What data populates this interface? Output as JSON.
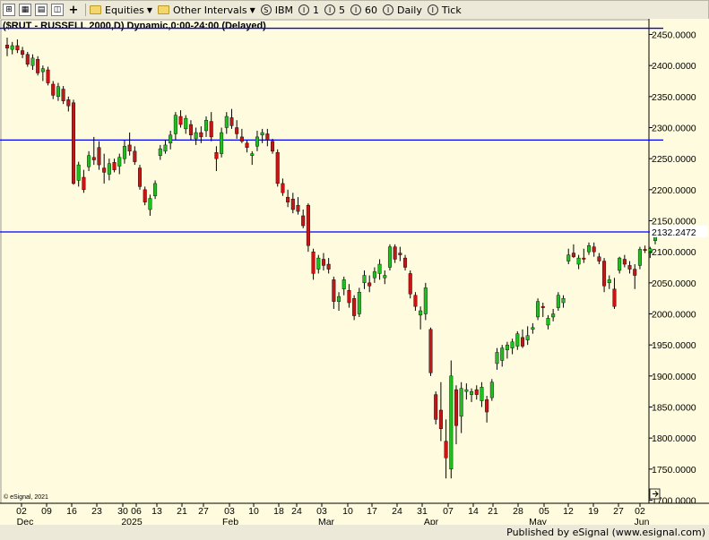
{
  "toolbar": {
    "equities_label": "Equities",
    "other_intervals_label": "Other Intervals",
    "symbol_label": "IBM",
    "interval_1": "1",
    "interval_5": "5",
    "interval_60": "60",
    "daily_label": "Daily",
    "tick_label": "Tick",
    "symbol_icon": "S",
    "interval_icon": "I"
  },
  "footer": {
    "published_text": "Published by eSignal (www.esignal.com)"
  },
  "chart_data": {
    "type": "candlestick",
    "title": "($RUT - RUSSELL 2000,D) Dynamic,0:00-24:00 (Delayed)",
    "watermark": "© eSignal, 2021",
    "y_range": [
      1700,
      2470
    ],
    "y_ticks": [
      "2450.0000",
      "2400.0000",
      "2350.0000",
      "2300.0000",
      "2250.0000",
      "2200.0000",
      "2150.0000",
      "2100.0000",
      "2050.0000",
      "2000.0000",
      "1950.0000",
      "1900.0000",
      "1850.0000",
      "1800.0000",
      "1750.0000",
      "1700.0000"
    ],
    "last_price_label": "2132.2472",
    "horizontal_lines": [
      2460,
      2280,
      2132
    ],
    "x_day_labels": [
      "02",
      "09",
      "16",
      "23",
      "30",
      "06",
      "13",
      "21",
      "27",
      "03",
      "10",
      "18",
      "24",
      "03",
      "10",
      "17",
      "24",
      "31",
      "07",
      "14",
      "21",
      "28",
      "05",
      "12",
      "19",
      "27",
      "02"
    ],
    "x_month_labels": [
      "Dec",
      "2025",
      "Feb",
      "Mar",
      "Apr",
      "May",
      "Jun"
    ],
    "colors": {
      "background": "#fefbde",
      "up": "#1fbf1f",
      "down": "#c81414",
      "line": "#0000ff",
      "wick": "#000000"
    },
    "candles": [
      {
        "o": 2433,
        "h": 2445,
        "l": 2415,
        "c": 2428
      },
      {
        "o": 2426,
        "h": 2438,
        "l": 2418,
        "c": 2432
      },
      {
        "o": 2432,
        "h": 2442,
        "l": 2420,
        "c": 2425
      },
      {
        "o": 2424,
        "h": 2430,
        "l": 2412,
        "c": 2418
      },
      {
        "o": 2418,
        "h": 2422,
        "l": 2398,
        "c": 2402
      },
      {
        "o": 2400,
        "h": 2418,
        "l": 2393,
        "c": 2412
      },
      {
        "o": 2410,
        "h": 2415,
        "l": 2384,
        "c": 2388
      },
      {
        "o": 2390,
        "h": 2400,
        "l": 2375,
        "c": 2395
      },
      {
        "o": 2393,
        "h": 2398,
        "l": 2368,
        "c": 2372
      },
      {
        "o": 2370,
        "h": 2375,
        "l": 2346,
        "c": 2352
      },
      {
        "o": 2350,
        "h": 2372,
        "l": 2343,
        "c": 2366
      },
      {
        "o": 2362,
        "h": 2367,
        "l": 2338,
        "c": 2343
      },
      {
        "o": 2345,
        "h": 2350,
        "l": 2326,
        "c": 2335
      },
      {
        "o": 2340,
        "h": 2345,
        "l": 2208,
        "c": 2210
      },
      {
        "o": 2215,
        "h": 2245,
        "l": 2205,
        "c": 2240
      },
      {
        "o": 2220,
        "h": 2232,
        "l": 2195,
        "c": 2200
      },
      {
        "o": 2237,
        "h": 2262,
        "l": 2230,
        "c": 2255
      },
      {
        "o": 2252,
        "h": 2285,
        "l": 2240,
        "c": 2248
      },
      {
        "o": 2268,
        "h": 2278,
        "l": 2232,
        "c": 2240
      },
      {
        "o": 2235,
        "h": 2258,
        "l": 2210,
        "c": 2228
      },
      {
        "o": 2225,
        "h": 2250,
        "l": 2215,
        "c": 2242
      },
      {
        "o": 2244,
        "h": 2250,
        "l": 2228,
        "c": 2232
      },
      {
        "o": 2238,
        "h": 2258,
        "l": 2225,
        "c": 2252
      },
      {
        "o": 2250,
        "h": 2280,
        "l": 2242,
        "c": 2270
      },
      {
        "o": 2272,
        "h": 2292,
        "l": 2255,
        "c": 2262
      },
      {
        "o": 2262,
        "h": 2270,
        "l": 2240,
        "c": 2245
      },
      {
        "o": 2235,
        "h": 2240,
        "l": 2200,
        "c": 2205
      },
      {
        "o": 2200,
        "h": 2205,
        "l": 2175,
        "c": 2180
      },
      {
        "o": 2168,
        "h": 2192,
        "l": 2158,
        "c": 2186
      },
      {
        "o": 2190,
        "h": 2215,
        "l": 2185,
        "c": 2210
      },
      {
        "o": 2255,
        "h": 2272,
        "l": 2248,
        "c": 2266
      },
      {
        "o": 2262,
        "h": 2280,
        "l": 2258,
        "c": 2272
      },
      {
        "o": 2275,
        "h": 2295,
        "l": 2265,
        "c": 2288
      },
      {
        "o": 2290,
        "h": 2325,
        "l": 2280,
        "c": 2320
      },
      {
        "o": 2318,
        "h": 2328,
        "l": 2300,
        "c": 2305
      },
      {
        "o": 2298,
        "h": 2320,
        "l": 2290,
        "c": 2315
      },
      {
        "o": 2305,
        "h": 2312,
        "l": 2280,
        "c": 2288
      },
      {
        "o": 2282,
        "h": 2300,
        "l": 2272,
        "c": 2292
      },
      {
        "o": 2292,
        "h": 2302,
        "l": 2275,
        "c": 2285
      },
      {
        "o": 2295,
        "h": 2318,
        "l": 2285,
        "c": 2312
      },
      {
        "o": 2310,
        "h": 2325,
        "l": 2278,
        "c": 2285
      },
      {
        "o": 2260,
        "h": 2270,
        "l": 2230,
        "c": 2250
      },
      {
        "o": 2258,
        "h": 2300,
        "l": 2252,
        "c": 2292
      },
      {
        "o": 2300,
        "h": 2325,
        "l": 2290,
        "c": 2318
      },
      {
        "o": 2316,
        "h": 2330,
        "l": 2298,
        "c": 2303
      },
      {
        "o": 2300,
        "h": 2312,
        "l": 2282,
        "c": 2290
      },
      {
        "o": 2285,
        "h": 2298,
        "l": 2275,
        "c": 2278
      },
      {
        "o": 2275,
        "h": 2280,
        "l": 2260,
        "c": 2268
      },
      {
        "o": 2255,
        "h": 2262,
        "l": 2240,
        "c": 2258
      },
      {
        "o": 2270,
        "h": 2295,
        "l": 2262,
        "c": 2285
      },
      {
        "o": 2288,
        "h": 2298,
        "l": 2275,
        "c": 2292
      },
      {
        "o": 2290,
        "h": 2298,
        "l": 2270,
        "c": 2280
      },
      {
        "o": 2278,
        "h": 2282,
        "l": 2258,
        "c": 2262
      },
      {
        "o": 2260,
        "h": 2265,
        "l": 2205,
        "c": 2210
      },
      {
        "o": 2210,
        "h": 2218,
        "l": 2190,
        "c": 2195
      },
      {
        "o": 2188,
        "h": 2200,
        "l": 2172,
        "c": 2180
      },
      {
        "o": 2185,
        "h": 2195,
        "l": 2162,
        "c": 2168
      },
      {
        "o": 2175,
        "h": 2188,
        "l": 2160,
        "c": 2165
      },
      {
        "o": 2158,
        "h": 2168,
        "l": 2138,
        "c": 2142
      },
      {
        "o": 2175,
        "h": 2178,
        "l": 2100,
        "c": 2110
      },
      {
        "o": 2100,
        "h": 2105,
        "l": 2055,
        "c": 2065
      },
      {
        "o": 2072,
        "h": 2095,
        "l": 2065,
        "c": 2090
      },
      {
        "o": 2088,
        "h": 2098,
        "l": 2070,
        "c": 2078
      },
      {
        "o": 2080,
        "h": 2090,
        "l": 2065,
        "c": 2072
      },
      {
        "o": 2055,
        "h": 2060,
        "l": 2008,
        "c": 2020
      },
      {
        "o": 2020,
        "h": 2035,
        "l": 2005,
        "c": 2028
      },
      {
        "o": 2040,
        "h": 2060,
        "l": 2030,
        "c": 2055
      },
      {
        "o": 2038,
        "h": 2048,
        "l": 2010,
        "c": 2018
      },
      {
        "o": 2025,
        "h": 2030,
        "l": 1990,
        "c": 1997
      },
      {
        "o": 2000,
        "h": 2042,
        "l": 1995,
        "c": 2035
      },
      {
        "o": 2050,
        "h": 2070,
        "l": 2040,
        "c": 2062
      },
      {
        "o": 2050,
        "h": 2062,
        "l": 2035,
        "c": 2045
      },
      {
        "o": 2058,
        "h": 2075,
        "l": 2050,
        "c": 2068
      },
      {
        "o": 2065,
        "h": 2088,
        "l": 2055,
        "c": 2080
      },
      {
        "o": 2058,
        "h": 2070,
        "l": 2048,
        "c": 2062
      },
      {
        "o": 2075,
        "h": 2112,
        "l": 2070,
        "c": 2108
      },
      {
        "o": 2108,
        "h": 2112,
        "l": 2082,
        "c": 2088
      },
      {
        "o": 2098,
        "h": 2108,
        "l": 2085,
        "c": 2095
      },
      {
        "o": 2090,
        "h": 2095,
        "l": 2070,
        "c": 2075
      },
      {
        "o": 2065,
        "h": 2070,
        "l": 2025,
        "c": 2032
      },
      {
        "o": 2030,
        "h": 2035,
        "l": 2005,
        "c": 2012
      },
      {
        "o": 1998,
        "h": 2012,
        "l": 1975,
        "c": 2005
      },
      {
        "o": 2000,
        "h": 2050,
        "l": 1990,
        "c": 2042
      },
      {
        "o": 1975,
        "h": 1978,
        "l": 1900,
        "c": 1905
      },
      {
        "o": 1870,
        "h": 1875,
        "l": 1822,
        "c": 1830
      },
      {
        "o": 1845,
        "h": 1890,
        "l": 1795,
        "c": 1815
      },
      {
        "o": 1795,
        "h": 1830,
        "l": 1735,
        "c": 1768
      },
      {
        "o": 1750,
        "h": 1925,
        "l": 1735,
        "c": 1900
      },
      {
        "o": 1878,
        "h": 1885,
        "l": 1790,
        "c": 1820
      },
      {
        "o": 1835,
        "h": 1890,
        "l": 1808,
        "c": 1880
      },
      {
        "o": 1875,
        "h": 1888,
        "l": 1862,
        "c": 1878
      },
      {
        "o": 1870,
        "h": 1880,
        "l": 1858,
        "c": 1875
      },
      {
        "o": 1878,
        "h": 1885,
        "l": 1862,
        "c": 1870
      },
      {
        "o": 1860,
        "h": 1890,
        "l": 1850,
        "c": 1882
      },
      {
        "o": 1862,
        "h": 1868,
        "l": 1825,
        "c": 1842
      },
      {
        "o": 1865,
        "h": 1895,
        "l": 1860,
        "c": 1890
      },
      {
        "o": 1920,
        "h": 1945,
        "l": 1910,
        "c": 1938
      },
      {
        "o": 1925,
        "h": 1950,
        "l": 1915,
        "c": 1945
      },
      {
        "o": 1942,
        "h": 1955,
        "l": 1928,
        "c": 1950
      },
      {
        "o": 1945,
        "h": 1960,
        "l": 1935,
        "c": 1955
      },
      {
        "o": 1948,
        "h": 1972,
        "l": 1942,
        "c": 1968
      },
      {
        "o": 1962,
        "h": 1975,
        "l": 1945,
        "c": 1948
      },
      {
        "o": 1958,
        "h": 1980,
        "l": 1950,
        "c": 1965
      },
      {
        "o": 1975,
        "h": 1985,
        "l": 1968,
        "c": 1978
      },
      {
        "o": 1995,
        "h": 2025,
        "l": 1990,
        "c": 2020
      },
      {
        "o": 2012,
        "h": 2018,
        "l": 1995,
        "c": 2010
      },
      {
        "o": 1982,
        "h": 1998,
        "l": 1975,
        "c": 1993
      },
      {
        "o": 1995,
        "h": 2008,
        "l": 1988,
        "c": 2000
      },
      {
        "o": 2010,
        "h": 2035,
        "l": 2005,
        "c": 2030
      },
      {
        "o": 2018,
        "h": 2030,
        "l": 2010,
        "c": 2025
      },
      {
        "o": 2085,
        "h": 2105,
        "l": 2080,
        "c": 2095
      },
      {
        "o": 2098,
        "h": 2112,
        "l": 2090,
        "c": 2092
      },
      {
        "o": 2080,
        "h": 2095,
        "l": 2072,
        "c": 2090
      },
      {
        "o": 2090,
        "h": 2105,
        "l": 2082,
        "c": 2088
      },
      {
        "o": 2100,
        "h": 2115,
        "l": 2095,
        "c": 2110
      },
      {
        "o": 2108,
        "h": 2115,
        "l": 2092,
        "c": 2100
      },
      {
        "o": 2092,
        "h": 2098,
        "l": 2080,
        "c": 2085
      },
      {
        "o": 2085,
        "h": 2090,
        "l": 2035,
        "c": 2045
      },
      {
        "o": 2050,
        "h": 2062,
        "l": 2040,
        "c": 2055
      },
      {
        "o": 2040,
        "h": 2058,
        "l": 2008,
        "c": 2012
      },
      {
        "o": 2070,
        "h": 2092,
        "l": 2065,
        "c": 2090
      },
      {
        "o": 2088,
        "h": 2095,
        "l": 2075,
        "c": 2080
      },
      {
        "o": 2078,
        "h": 2085,
        "l": 2065,
        "c": 2072
      },
      {
        "o": 2072,
        "h": 2080,
        "l": 2040,
        "c": 2062
      },
      {
        "o": 2078,
        "h": 2108,
        "l": 2072,
        "c": 2104
      },
      {
        "o": 2104,
        "h": 2110,
        "l": 2098,
        "c": 2102
      },
      {
        "o": 2098,
        "h": 2108,
        "l": 2090,
        "c": 2105
      },
      {
        "o": 2118,
        "h": 2136,
        "l": 2112,
        "c": 2132
      }
    ]
  }
}
